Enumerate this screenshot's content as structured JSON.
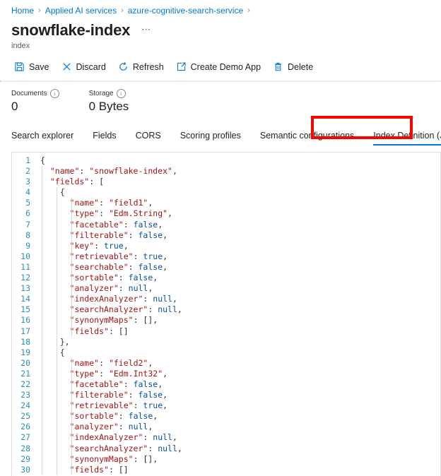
{
  "breadcrumb": {
    "items": [
      {
        "label": "Home"
      },
      {
        "label": "Applied AI services"
      },
      {
        "label": "azure-cognitive-search-service"
      }
    ],
    "separator": "›"
  },
  "header": {
    "title": "snowflake-index",
    "subtitle": "index",
    "more_label": "⋯"
  },
  "toolbar": {
    "items": [
      {
        "label": "Save",
        "icon": "save-icon"
      },
      {
        "label": "Discard",
        "icon": "discard-icon"
      },
      {
        "label": "Refresh",
        "icon": "refresh-icon"
      },
      {
        "label": "Create Demo App",
        "icon": "open-in-new-icon"
      },
      {
        "label": "Delete",
        "icon": "trash-icon"
      }
    ]
  },
  "metrics": [
    {
      "label": "Documents",
      "value": "0",
      "info": "i"
    },
    {
      "label": "Storage",
      "value": "0 Bytes",
      "info": "i"
    }
  ],
  "tabs": [
    {
      "label": "Search explorer",
      "active": false
    },
    {
      "label": "Fields",
      "active": false
    },
    {
      "label": "CORS",
      "active": false
    },
    {
      "label": "Scoring profiles",
      "active": false
    },
    {
      "label": "Semantic configurations",
      "active": false
    },
    {
      "label": "Index Definition (JSON)",
      "active": true,
      "highlighted": true
    }
  ],
  "colors": {
    "accent": "#0078d4",
    "highlight_box": "#ff0000",
    "json_key": "#a31515",
    "json_keyword": "#0451a5",
    "line_number": "#2b91af"
  },
  "editor": {
    "language": "json",
    "lines": [
      {
        "n": 1,
        "guides": 0,
        "tokens": [
          {
            "t": "pun",
            "v": "{"
          }
        ]
      },
      {
        "n": 2,
        "guides": 1,
        "tokens": [
          {
            "t": "key",
            "v": "  \"name\""
          },
          {
            "t": "pun",
            "v": ": "
          },
          {
            "t": "str",
            "v": "\"snowflake-index\""
          },
          {
            "t": "pun",
            "v": ","
          }
        ]
      },
      {
        "n": 3,
        "guides": 1,
        "tokens": [
          {
            "t": "key",
            "v": "  \"fields\""
          },
          {
            "t": "pun",
            "v": ": ["
          }
        ]
      },
      {
        "n": 4,
        "guides": 2,
        "tokens": [
          {
            "t": "pun",
            "v": "    {"
          }
        ]
      },
      {
        "n": 5,
        "guides": 3,
        "tokens": [
          {
            "t": "key",
            "v": "      \"name\""
          },
          {
            "t": "pun",
            "v": ": "
          },
          {
            "t": "str",
            "v": "\"field1\""
          },
          {
            "t": "pun",
            "v": ","
          }
        ]
      },
      {
        "n": 6,
        "guides": 3,
        "tokens": [
          {
            "t": "key",
            "v": "      \"type\""
          },
          {
            "t": "pun",
            "v": ": "
          },
          {
            "t": "str",
            "v": "\"Edm.String\""
          },
          {
            "t": "pun",
            "v": ","
          }
        ]
      },
      {
        "n": 7,
        "guides": 3,
        "tokens": [
          {
            "t": "key",
            "v": "      \"facetable\""
          },
          {
            "t": "pun",
            "v": ": "
          },
          {
            "t": "kw",
            "v": "false"
          },
          {
            "t": "pun",
            "v": ","
          }
        ]
      },
      {
        "n": 8,
        "guides": 3,
        "tokens": [
          {
            "t": "key",
            "v": "      \"filterable\""
          },
          {
            "t": "pun",
            "v": ": "
          },
          {
            "t": "kw",
            "v": "false"
          },
          {
            "t": "pun",
            "v": ","
          }
        ]
      },
      {
        "n": 9,
        "guides": 3,
        "tokens": [
          {
            "t": "key",
            "v": "      \"key\""
          },
          {
            "t": "pun",
            "v": ": "
          },
          {
            "t": "kw",
            "v": "true"
          },
          {
            "t": "pun",
            "v": ","
          }
        ]
      },
      {
        "n": 10,
        "guides": 3,
        "tokens": [
          {
            "t": "key",
            "v": "      \"retrievable\""
          },
          {
            "t": "pun",
            "v": ": "
          },
          {
            "t": "kw",
            "v": "true"
          },
          {
            "t": "pun",
            "v": ","
          }
        ]
      },
      {
        "n": 11,
        "guides": 3,
        "tokens": [
          {
            "t": "key",
            "v": "      \"searchable\""
          },
          {
            "t": "pun",
            "v": ": "
          },
          {
            "t": "kw",
            "v": "false"
          },
          {
            "t": "pun",
            "v": ","
          }
        ]
      },
      {
        "n": 12,
        "guides": 3,
        "tokens": [
          {
            "t": "key",
            "v": "      \"sortable\""
          },
          {
            "t": "pun",
            "v": ": "
          },
          {
            "t": "kw",
            "v": "false"
          },
          {
            "t": "pun",
            "v": ","
          }
        ]
      },
      {
        "n": 13,
        "guides": 3,
        "tokens": [
          {
            "t": "key",
            "v": "      \"analyzer\""
          },
          {
            "t": "pun",
            "v": ": "
          },
          {
            "t": "kw",
            "v": "null"
          },
          {
            "t": "pun",
            "v": ","
          }
        ]
      },
      {
        "n": 14,
        "guides": 3,
        "tokens": [
          {
            "t": "key",
            "v": "      \"indexAnalyzer\""
          },
          {
            "t": "pun",
            "v": ": "
          },
          {
            "t": "kw",
            "v": "null"
          },
          {
            "t": "pun",
            "v": ","
          }
        ]
      },
      {
        "n": 15,
        "guides": 3,
        "tokens": [
          {
            "t": "key",
            "v": "      \"searchAnalyzer\""
          },
          {
            "t": "pun",
            "v": ": "
          },
          {
            "t": "kw",
            "v": "null"
          },
          {
            "t": "pun",
            "v": ","
          }
        ]
      },
      {
        "n": 16,
        "guides": 3,
        "tokens": [
          {
            "t": "key",
            "v": "      \"synonymMaps\""
          },
          {
            "t": "pun",
            "v": ": [],"
          }
        ]
      },
      {
        "n": 17,
        "guides": 3,
        "tokens": [
          {
            "t": "key",
            "v": "      \"fields\""
          },
          {
            "t": "pun",
            "v": ": []"
          }
        ]
      },
      {
        "n": 18,
        "guides": 2,
        "tokens": [
          {
            "t": "pun",
            "v": "    },"
          }
        ]
      },
      {
        "n": 19,
        "guides": 2,
        "tokens": [
          {
            "t": "pun",
            "v": "    {"
          }
        ]
      },
      {
        "n": 20,
        "guides": 3,
        "tokens": [
          {
            "t": "key",
            "v": "      \"name\""
          },
          {
            "t": "pun",
            "v": ": "
          },
          {
            "t": "str",
            "v": "\"field2\""
          },
          {
            "t": "pun",
            "v": ","
          }
        ]
      },
      {
        "n": 21,
        "guides": 3,
        "tokens": [
          {
            "t": "key",
            "v": "      \"type\""
          },
          {
            "t": "pun",
            "v": ": "
          },
          {
            "t": "str",
            "v": "\"Edm.Int32\""
          },
          {
            "t": "pun",
            "v": ","
          }
        ]
      },
      {
        "n": 22,
        "guides": 3,
        "tokens": [
          {
            "t": "key",
            "v": "      \"facetable\""
          },
          {
            "t": "pun",
            "v": ": "
          },
          {
            "t": "kw",
            "v": "false"
          },
          {
            "t": "pun",
            "v": ","
          }
        ]
      },
      {
        "n": 23,
        "guides": 3,
        "tokens": [
          {
            "t": "key",
            "v": "      \"filterable\""
          },
          {
            "t": "pun",
            "v": ": "
          },
          {
            "t": "kw",
            "v": "false"
          },
          {
            "t": "pun",
            "v": ","
          }
        ]
      },
      {
        "n": 24,
        "guides": 3,
        "tokens": [
          {
            "t": "key",
            "v": "      \"retrievable\""
          },
          {
            "t": "pun",
            "v": ": "
          },
          {
            "t": "kw",
            "v": "true"
          },
          {
            "t": "pun",
            "v": ","
          }
        ]
      },
      {
        "n": 25,
        "guides": 3,
        "tokens": [
          {
            "t": "key",
            "v": "      \"sortable\""
          },
          {
            "t": "pun",
            "v": ": "
          },
          {
            "t": "kw",
            "v": "false"
          },
          {
            "t": "pun",
            "v": ","
          }
        ]
      },
      {
        "n": 26,
        "guides": 3,
        "tokens": [
          {
            "t": "key",
            "v": "      \"analyzer\""
          },
          {
            "t": "pun",
            "v": ": "
          },
          {
            "t": "kw",
            "v": "null"
          },
          {
            "t": "pun",
            "v": ","
          }
        ]
      },
      {
        "n": 27,
        "guides": 3,
        "tokens": [
          {
            "t": "key",
            "v": "      \"indexAnalyzer\""
          },
          {
            "t": "pun",
            "v": ": "
          },
          {
            "t": "kw",
            "v": "null"
          },
          {
            "t": "pun",
            "v": ","
          }
        ]
      },
      {
        "n": 28,
        "guides": 3,
        "tokens": [
          {
            "t": "key",
            "v": "      \"searchAnalyzer\""
          },
          {
            "t": "pun",
            "v": ": "
          },
          {
            "t": "kw",
            "v": "null"
          },
          {
            "t": "pun",
            "v": ","
          }
        ]
      },
      {
        "n": 29,
        "guides": 3,
        "tokens": [
          {
            "t": "key",
            "v": "      \"synonymMaps\""
          },
          {
            "t": "pun",
            "v": ": [],"
          }
        ]
      },
      {
        "n": 30,
        "guides": 3,
        "tokens": [
          {
            "t": "key",
            "v": "      \"fields\""
          },
          {
            "t": "pun",
            "v": ": []"
          }
        ]
      }
    ]
  }
}
